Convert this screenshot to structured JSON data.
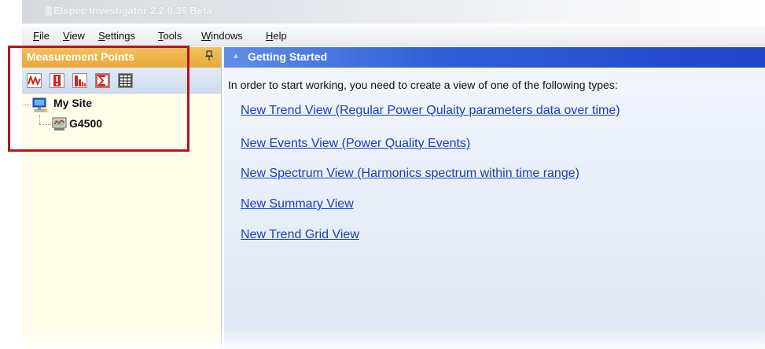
{
  "window": {
    "title": "Elspec Investigator 2.2.0.35 Beta"
  },
  "menu": {
    "items": [
      {
        "label": "File",
        "u": "F",
        "rest": "ile"
      },
      {
        "label": "View",
        "u": "V",
        "rest": "iew"
      },
      {
        "label": "Settings",
        "u": "S",
        "rest": "ettings"
      },
      {
        "label": "Tools",
        "u": "T",
        "rest": "ools"
      },
      {
        "label": "Windows",
        "u": "W",
        "rest": "indows"
      },
      {
        "label": "Help",
        "u": "H",
        "rest": "elp"
      }
    ]
  },
  "measurement_points": {
    "title": "Measurement Points",
    "pin_icon": "pin-icon",
    "toolbar": [
      {
        "icon": "trend-view-icon",
        "color": "#d32121"
      },
      {
        "icon": "events-view-icon",
        "color": "#d32121"
      },
      {
        "icon": "spectrum-view-icon",
        "color": "#d32121"
      },
      {
        "icon": "summary-view-icon",
        "color": "#d32121"
      },
      {
        "icon": "trend-grid-view-icon",
        "color": "#222222"
      }
    ],
    "tree": {
      "site_label": "My Site",
      "device_label": "G4500"
    }
  },
  "getting_started": {
    "title": "Getting Started",
    "intro": "In order to start working, you need to create a view of one of the following types:",
    "links": [
      "New Trend View (Regular Power Qulaity parameters data over time)",
      "New Events View (Power Quality Events)",
      "New Spectrum View (Harmonics spectrum within time range)",
      "New Summary View",
      "New Trend Grid View"
    ]
  },
  "colors": {
    "highlight_box": "#b5141b",
    "panel_header": "#e8a93a",
    "main_header": "#2f5fd8",
    "link": "#1a3fb6"
  }
}
